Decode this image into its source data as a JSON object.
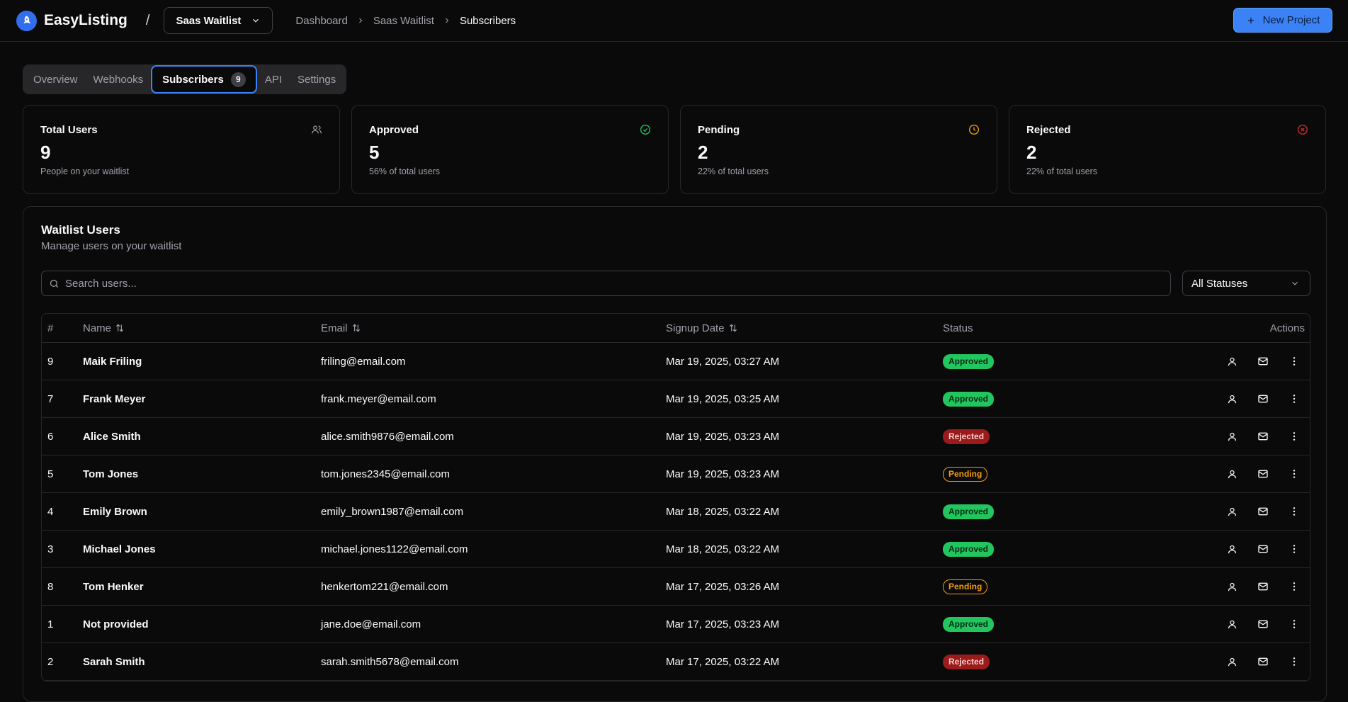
{
  "app": {
    "name": "EasyListing"
  },
  "project_select": {
    "value": "Saas Waitlist"
  },
  "breadcrumb": [
    "Dashboard",
    "Saas Waitlist",
    "Subscribers"
  ],
  "new_project_label": "New Project",
  "tabs": [
    {
      "label": "Overview"
    },
    {
      "label": "Webhooks"
    },
    {
      "label": "Subscribers",
      "badge": "9",
      "active": true
    },
    {
      "label": "API"
    },
    {
      "label": "Settings"
    }
  ],
  "stats": [
    {
      "title": "Total Users",
      "value": "9",
      "sub": "People on your waitlist",
      "icon": "users-icon",
      "color": "#a1a1aa"
    },
    {
      "title": "Approved",
      "value": "5",
      "sub": "56% of total users",
      "icon": "check-circle-icon",
      "color": "#22c55e"
    },
    {
      "title": "Pending",
      "value": "2",
      "sub": "22% of total users",
      "icon": "clock-icon",
      "color": "#f59e0b"
    },
    {
      "title": "Rejected",
      "value": "2",
      "sub": "22% of total users",
      "icon": "x-circle-icon",
      "color": "#dc2626"
    }
  ],
  "panel": {
    "title": "Waitlist Users",
    "description": "Manage users on your waitlist"
  },
  "search": {
    "placeholder": "Search users..."
  },
  "status_filter": {
    "value": "All Statuses"
  },
  "table": {
    "headers": {
      "num": "#",
      "name": "Name",
      "email": "Email",
      "date": "Signup Date",
      "status": "Status",
      "actions": "Actions"
    },
    "rows": [
      {
        "num": "9",
        "name": "Maik Friling",
        "email": "friling@email.com",
        "date": "Mar 19, 2025, 03:27 AM",
        "status": "Approved"
      },
      {
        "num": "7",
        "name": "Frank Meyer",
        "email": "frank.meyer@email.com",
        "date": "Mar 19, 2025, 03:25 AM",
        "status": "Approved"
      },
      {
        "num": "6",
        "name": "Alice Smith",
        "email": "alice.smith9876@email.com",
        "date": "Mar 19, 2025, 03:23 AM",
        "status": "Rejected"
      },
      {
        "num": "5",
        "name": "Tom Jones",
        "email": "tom.jones2345@email.com",
        "date": "Mar 19, 2025, 03:23 AM",
        "status": "Pending"
      },
      {
        "num": "4",
        "name": "Emily Brown",
        "email": "emily_brown1987@email.com",
        "date": "Mar 18, 2025, 03:22 AM",
        "status": "Approved"
      },
      {
        "num": "3",
        "name": "Michael Jones",
        "email": "michael.jones1122@email.com",
        "date": "Mar 18, 2025, 03:22 AM",
        "status": "Approved"
      },
      {
        "num": "8",
        "name": "Tom Henker",
        "email": "henkertom221@email.com",
        "date": "Mar 17, 2025, 03:26 AM",
        "status": "Pending"
      },
      {
        "num": "1",
        "name": "Not provided",
        "email": "jane.doe@email.com",
        "date": "Mar 17, 2025, 03:23 AM",
        "status": "Approved"
      },
      {
        "num": "2",
        "name": "Sarah Smith",
        "email": "sarah.smith5678@email.com",
        "date": "Mar 17, 2025, 03:22 AM",
        "status": "Rejected"
      }
    ]
  },
  "colors": {
    "accent": "#3b82f6",
    "approved": "#22c55e",
    "pending": "#f59e0b",
    "rejected": "#991b1b"
  }
}
